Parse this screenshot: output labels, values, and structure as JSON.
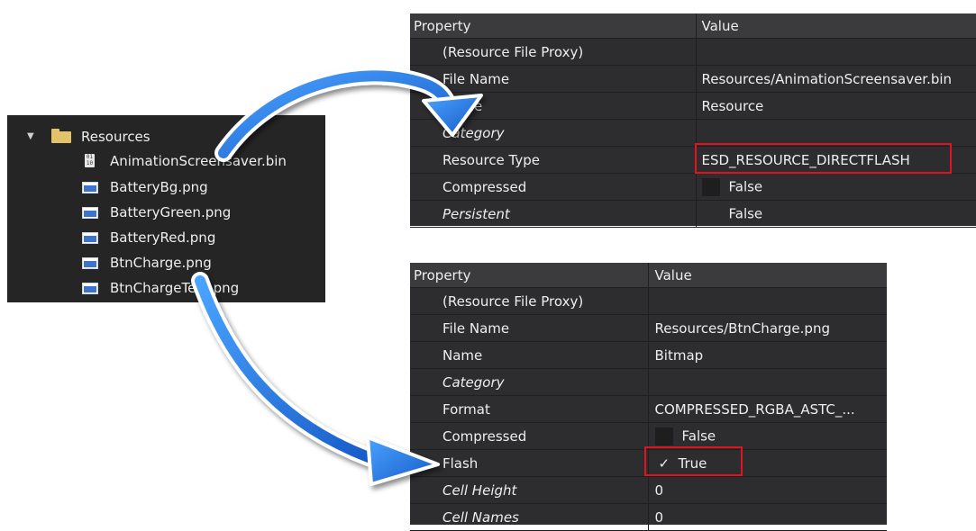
{
  "tree": {
    "root": "Resources",
    "items": [
      {
        "label": "AnimationScreensaver.bin",
        "icon": "bin-file-icon"
      },
      {
        "label": "BatteryBg.png",
        "icon": "image-file-icon"
      },
      {
        "label": "BatteryGreen.png",
        "icon": "image-file-icon"
      },
      {
        "label": "BatteryRed.png",
        "icon": "image-file-icon"
      },
      {
        "label": "BtnCharge.png",
        "icon": "image-file-icon"
      },
      {
        "label": "BtnChargeText.png",
        "icon": "image-file-icon"
      }
    ]
  },
  "grid1": {
    "header": {
      "property": "Property",
      "value": "Value"
    },
    "rows": [
      {
        "key": "(Resource File Proxy)",
        "value": ""
      },
      {
        "key": "File Name",
        "value": "Resources/AnimationScreensaver.bin"
      },
      {
        "key": "Name",
        "value": "Resource"
      },
      {
        "key": "Category",
        "value": ""
      },
      {
        "key": "Resource Type",
        "value": "ESD_RESOURCE_DIRECTFLASH"
      },
      {
        "key": "Compressed",
        "value": "False"
      },
      {
        "key": "Persistent",
        "value": "False"
      }
    ]
  },
  "grid2": {
    "header": {
      "property": "Property",
      "value": "Value"
    },
    "rows": [
      {
        "key": "(Resource File Proxy)",
        "value": ""
      },
      {
        "key": "File Name",
        "value": "Resources/BtnCharge.png"
      },
      {
        "key": "Name",
        "value": "Bitmap"
      },
      {
        "key": "Category",
        "value": ""
      },
      {
        "key": "Format",
        "value": "COMPRESSED_RGBA_ASTC_..."
      },
      {
        "key": "Compressed",
        "value": "False"
      },
      {
        "key": "Flash",
        "value": "True",
        "check": "✓"
      },
      {
        "key": "Cell Height",
        "value": "0"
      },
      {
        "key": "Cell Names",
        "value": "0"
      }
    ]
  },
  "colors": {
    "highlight": "#e0141e",
    "arrow": "#1e6fd9",
    "panel": "#2d2d30"
  }
}
